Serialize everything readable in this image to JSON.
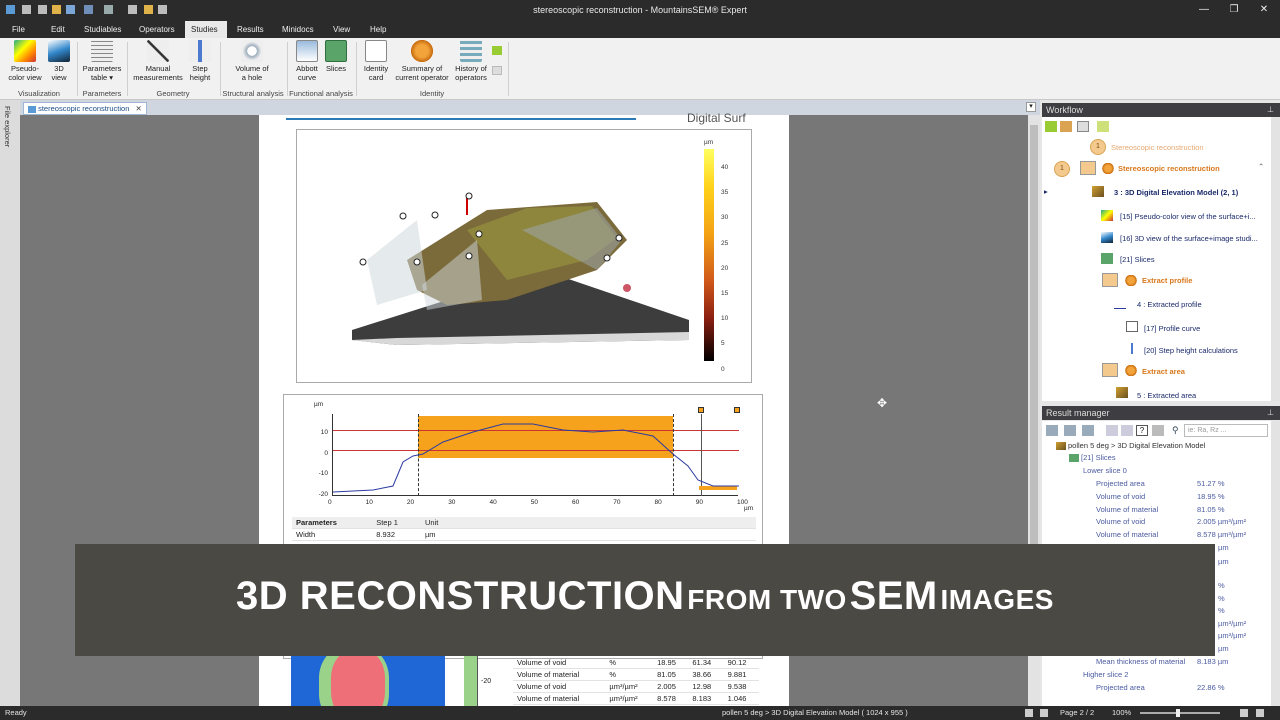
{
  "window": {
    "title": "stereoscopic reconstruction - MountainsSEM® Expert"
  },
  "menu": {
    "items": [
      "File",
      "Edit",
      "Studiables",
      "Operators",
      "Studies",
      "Results",
      "Minidocs",
      "View",
      "Help"
    ],
    "active": "Studies"
  },
  "ribbon": {
    "buttons": [
      {
        "l1": "Pseudo-",
        "l2": "color view"
      },
      {
        "l1": "3D",
        "l2": "view"
      },
      {
        "l1": "Parameters",
        "l2": "table ▾"
      },
      {
        "l1": "Manual",
        "l2": "measurements"
      },
      {
        "l1": "Step",
        "l2": "height"
      },
      {
        "l1": "Volume of",
        "l2": "a hole"
      },
      {
        "l1": "Abbott",
        "l2": "curve"
      },
      {
        "l1": "Slices",
        "l2": ""
      },
      {
        "l1": "Identity",
        "l2": "card"
      },
      {
        "l1": "Summary of",
        "l2": "current operator"
      },
      {
        "l1": "History of",
        "l2": "operators"
      }
    ],
    "groups": [
      "Visualization",
      "Parameters",
      "Geometry",
      "Structural analysis",
      "Functional analysis",
      "Identity"
    ]
  },
  "sidestrip": {
    "label": "File explorer"
  },
  "doc_tab": {
    "label": "stereoscopic reconstruction",
    "close": "✕"
  },
  "page": {
    "header_logo": "Digital Surf",
    "colorbar": {
      "unit": "µm",
      "ticks": [
        "40",
        "35",
        "30",
        "25",
        "20",
        "15",
        "10",
        "5",
        "0"
      ]
    },
    "profile": {
      "yunit": "µm",
      "yticks": [
        "10",
        "0",
        "-10",
        "-20"
      ],
      "xticks": [
        "0",
        "10",
        "20",
        "30",
        "40",
        "50",
        "60",
        "70",
        "80",
        "90",
        "100"
      ],
      "xunit": "µm"
    },
    "table1": {
      "headers": [
        "Parameters",
        "Step 1",
        "Unit"
      ],
      "rows": [
        [
          "Width",
          "8.932",
          "µm"
        ]
      ]
    },
    "table2": {
      "rows": [
        [
          "Volume of void",
          "%",
          "18.95",
          "61.34",
          "90.12"
        ],
        [
          "Volume of material",
          "%",
          "81.05",
          "38.66",
          "9.881"
        ],
        [
          "Volume of void",
          "µm³/µm²",
          "2.005",
          "12.98",
          "9.538"
        ],
        [
          "Volume of material",
          "µm³/µm²",
          "8.578",
          "8.183",
          "1.046"
        ]
      ]
    },
    "mini_axis": "-20"
  },
  "workflow": {
    "title": "Workflow",
    "items": [
      {
        "text": "Stereoscopic reconstruction"
      },
      {
        "text": "Stereoscopic reconstruction"
      },
      {
        "text": "3 : 3D Digital Elevation Model (2, 1)"
      },
      {
        "text": "[15] Pseudo-color view of the surface+i..."
      },
      {
        "text": "[16] 3D view of the surface+image studi..."
      },
      {
        "text": "[21] Slices"
      },
      {
        "text": "Extract profile"
      },
      {
        "text": "4 : Extracted profile"
      },
      {
        "text": "[17] Profile curve"
      },
      {
        "text": "[20] Step height calculations"
      },
      {
        "text": "Extract area"
      },
      {
        "text": "5 : Extracted area"
      }
    ],
    "circles": [
      "1",
      "1"
    ]
  },
  "result_manager": {
    "title": "Result manager",
    "search_placeholder": "ie: Ra, Rz ...",
    "path": "pollen 5 deg > 3D Digital Elevation Model",
    "slices": "[21] Slices",
    "lower": "Lower slice 0",
    "rows": [
      {
        "name": "Projected area",
        "value": "51.27 %"
      },
      {
        "name": "Volume of void",
        "value": "18.95 %"
      },
      {
        "name": "Volume of material",
        "value": "81.05 %"
      },
      {
        "name": "Volume of void",
        "value": "2.005 µm³/µm²"
      },
      {
        "name": "Volume of material",
        "value": "8.578 µm³/µm²"
      }
    ],
    "right_fragments": [
      "µm",
      "µm",
      "%",
      "%",
      "%",
      "µm³/µm²",
      "µm³/µm²",
      "µm"
    ],
    "mean_thickness": {
      "name": "Mean thickness of material",
      "value": "8.183 µm"
    },
    "higher": "Higher slice 2",
    "higher_row": {
      "name": "Projected area",
      "value": "22.86 %"
    }
  },
  "status": {
    "left": "Ready",
    "path": "pollen 5 deg > 3D Digital Elevation Model ( 1024 x 955 )",
    "page": "Page 2 / 2",
    "zoom": "100%"
  },
  "banner": {
    "big1": "3D RECONSTRUCTION",
    "small1": "FROM TWO",
    "big2": "SEM",
    "small2": "IMAGES"
  }
}
